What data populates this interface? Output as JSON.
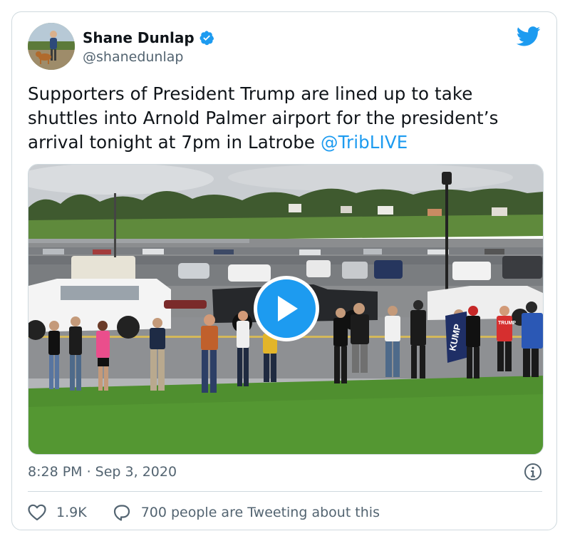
{
  "tweet": {
    "author": {
      "display_name": "Shane Dunlap",
      "handle": "@shanedunlap",
      "verified": true
    },
    "text_main": "Supporters of President Trump are lined up to take shuttles into Arnold Palmer airport for the president’s arrival tonight at 7pm in Latrobe ",
    "mention": "@TribLIVE",
    "timestamp": "8:28 PM · Sep 3, 2020",
    "likes": "1.9K",
    "reply_text": "700 people are Tweeting about this"
  },
  "media": {
    "type": "video",
    "sign_text": "TRUMP",
    "flag_text": "KUMP"
  },
  "colors": {
    "accent": "#1d9bf0",
    "text": "#0f1419",
    "muted": "#536471",
    "border": "#cfd9de"
  },
  "icons": {
    "brand": "twitter-bird-icon",
    "verified": "verified-badge-icon",
    "play": "play-icon",
    "info": "info-icon",
    "like": "heart-icon",
    "reply": "speech-bubble-icon"
  }
}
